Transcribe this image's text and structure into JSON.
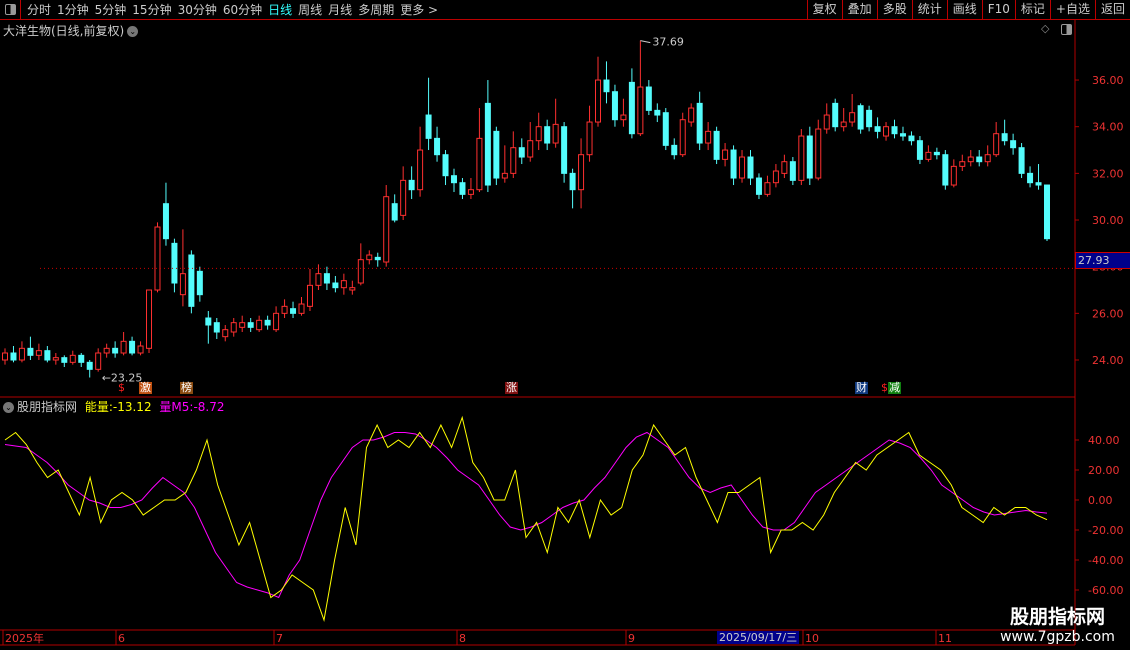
{
  "toolbar": {
    "periods": [
      "分时",
      "1分钟",
      "5分钟",
      "15分钟",
      "30分钟",
      "60分钟",
      "日线",
      "周线",
      "月线",
      "多周期",
      "更多 >"
    ],
    "active_period": "日线",
    "actions": [
      "复权",
      "叠加",
      "多股",
      "统计",
      "画线",
      "F10",
      "标记",
      "+自选",
      "返回"
    ]
  },
  "main": {
    "title": "大洋生物(日线,前复权)",
    "price_ticks": [
      "36.00",
      "34.00",
      "32.00",
      "30.00",
      "28.00",
      "26.00",
      "24.00"
    ],
    "current_price": "27.93",
    "high_label": "37.69",
    "low_label": "23.25",
    "markers": [
      {
        "text": "$",
        "bg": "",
        "color": "#ff2020"
      },
      {
        "text": "激",
        "bg": "#c05010",
        "color": "#fff"
      },
      {
        "text": "榜",
        "bg": "#8a4a10",
        "color": "#fff"
      },
      {
        "text": "涨",
        "bg": "#801010",
        "color": "#fff"
      },
      {
        "text": "财",
        "bg": "#103a80",
        "color": "#fff"
      },
      {
        "text": "$",
        "bg": "",
        "color": "#ff2020"
      },
      {
        "text": "减",
        "bg": "#108010",
        "color": "#fff"
      }
    ]
  },
  "indicator": {
    "name": "股朋指标网",
    "line1_label": "能量:",
    "line1_value": "-13.12",
    "line2_label": "量M5:",
    "line2_value": "-8.72",
    "ticks": [
      "40.00",
      "20.00",
      "0.00",
      "-20.00",
      "-40.00",
      "-60.00"
    ],
    "colors": {
      "line1": "#ffff00",
      "line2": "#ff00ff"
    },
    "line1": [
      40,
      45,
      37,
      25,
      15,
      20,
      5,
      -10,
      15,
      -15,
      0,
      5,
      0,
      -10,
      -5,
      0,
      0,
      5,
      20,
      40,
      10,
      -10,
      -30,
      -15,
      -40,
      -65,
      -60,
      -50,
      -55,
      -60,
      -80,
      -40,
      -5,
      -30,
      35,
      50,
      35,
      40,
      35,
      45,
      35,
      50,
      35,
      55,
      25,
      15,
      0,
      0,
      20,
      -25,
      -15,
      -35,
      -5,
      -15,
      0,
      -25,
      0,
      -10,
      -5,
      20,
      30,
      50,
      40,
      30,
      35,
      15,
      0,
      -15,
      5,
      5,
      10,
      15,
      -35,
      -20,
      -20,
      -15,
      -20,
      -10,
      5,
      15,
      25,
      20,
      30,
      35,
      40,
      45,
      30,
      25,
      20,
      10,
      -5,
      -10,
      -15,
      -5,
      -10,
      -5,
      -5,
      -10,
      -13.12
    ],
    "line2": [
      37,
      36,
      35,
      30,
      25,
      18,
      10,
      5,
      0,
      -2,
      -5,
      -5,
      -3,
      0,
      8,
      15,
      10,
      5,
      -5,
      -20,
      -35,
      -45,
      -55,
      -58,
      -60,
      -62,
      -65,
      -50,
      -40,
      -20,
      0,
      15,
      25,
      35,
      40,
      40,
      42,
      45,
      45,
      44,
      40,
      35,
      28,
      20,
      15,
      10,
      0,
      -10,
      -18,
      -20,
      -18,
      -15,
      -10,
      -5,
      -2,
      0,
      8,
      15,
      25,
      35,
      42,
      45,
      40,
      35,
      25,
      15,
      8,
      5,
      8,
      10,
      0,
      -10,
      -18,
      -20,
      -20,
      -15,
      -5,
      5,
      10,
      15,
      20,
      25,
      30,
      35,
      40,
      38,
      35,
      28,
      20,
      10,
      5,
      0,
      -5,
      -8,
      -10,
      -9,
      -8,
      -7,
      -8,
      -8.72
    ]
  },
  "candles": [
    [
      24.0,
      24.3,
      24.5,
      23.8
    ],
    [
      24.3,
      24.0,
      24.6,
      23.9
    ],
    [
      24.0,
      24.5,
      24.8,
      23.9
    ],
    [
      24.5,
      24.2,
      25.0,
      24.0
    ],
    [
      24.2,
      24.4,
      24.7,
      24.0
    ],
    [
      24.4,
      24.0,
      24.6,
      23.9
    ],
    [
      24.0,
      24.1,
      24.3,
      23.8
    ],
    [
      24.1,
      23.9,
      24.2,
      23.7
    ],
    [
      23.9,
      24.2,
      24.4,
      23.8
    ],
    [
      24.2,
      23.9,
      24.3,
      23.7
    ],
    [
      23.9,
      23.6,
      24.0,
      23.25
    ],
    [
      23.6,
      24.3,
      24.5,
      23.5
    ],
    [
      24.3,
      24.5,
      24.7,
      24.1
    ],
    [
      24.5,
      24.3,
      24.8,
      24.1
    ],
    [
      24.3,
      24.8,
      25.2,
      24.2
    ],
    [
      24.8,
      24.3,
      25.0,
      24.2
    ],
    [
      24.3,
      24.6,
      24.8,
      24.2
    ],
    [
      24.5,
      27.0,
      27.0,
      24.3
    ],
    [
      27.0,
      29.7,
      29.9,
      26.9
    ],
    [
      30.7,
      29.2,
      31.6,
      28.9
    ],
    [
      29.0,
      27.3,
      29.2,
      26.9
    ],
    [
      26.8,
      27.7,
      29.6,
      26.3
    ],
    [
      28.5,
      26.3,
      28.7,
      26.0
    ],
    [
      27.8,
      26.8,
      28.0,
      26.5
    ],
    [
      25.8,
      25.5,
      26.1,
      24.7
    ],
    [
      25.6,
      25.2,
      25.8,
      24.9
    ],
    [
      25.0,
      25.3,
      25.5,
      24.8
    ],
    [
      25.2,
      25.6,
      25.8,
      25.0
    ],
    [
      25.4,
      25.6,
      25.9,
      25.2
    ],
    [
      25.6,
      25.4,
      25.8,
      25.2
    ],
    [
      25.3,
      25.7,
      25.9,
      25.2
    ],
    [
      25.7,
      25.5,
      25.9,
      25.3
    ],
    [
      25.3,
      26.0,
      26.3,
      25.2
    ],
    [
      26.0,
      26.3,
      26.6,
      25.8
    ],
    [
      26.2,
      26.0,
      26.5,
      25.8
    ],
    [
      26.0,
      26.4,
      26.7,
      25.9
    ],
    [
      26.3,
      27.2,
      27.9,
      26.1
    ],
    [
      27.2,
      27.7,
      28.1,
      27.0
    ],
    [
      27.7,
      27.3,
      28.0,
      27.0
    ],
    [
      27.3,
      27.1,
      27.6,
      26.9
    ],
    [
      27.1,
      27.4,
      27.7,
      26.8
    ],
    [
      27.0,
      27.1,
      27.4,
      26.8
    ],
    [
      27.3,
      28.3,
      29.0,
      27.2
    ],
    [
      28.3,
      28.5,
      28.7,
      28.1
    ],
    [
      28.4,
      28.3,
      28.6,
      28.0
    ],
    [
      28.2,
      31.0,
      31.5,
      28.0
    ],
    [
      30.7,
      30.0,
      31.1,
      29.9
    ],
    [
      30.2,
      31.7,
      32.3,
      30.0
    ],
    [
      31.7,
      31.3,
      32.3,
      30.9
    ],
    [
      31.3,
      33.0,
      34.0,
      31.0
    ],
    [
      34.5,
      33.5,
      36.1,
      33.0
    ],
    [
      33.5,
      32.8,
      34.0,
      32.5
    ],
    [
      32.8,
      31.9,
      33.0,
      31.5
    ],
    [
      31.9,
      31.6,
      32.2,
      31.2
    ],
    [
      31.6,
      31.1,
      31.8,
      30.9
    ],
    [
      31.1,
      31.3,
      31.8,
      30.9
    ],
    [
      31.3,
      33.5,
      34.8,
      31.2
    ],
    [
      35.0,
      31.5,
      36.0,
      31.2
    ],
    [
      33.8,
      31.8,
      34.0,
      31.5
    ],
    [
      31.8,
      32.0,
      33.2,
      31.6
    ],
    [
      32.0,
      33.1,
      33.8,
      31.8
    ],
    [
      33.1,
      32.7,
      33.5,
      32.4
    ],
    [
      32.7,
      33.4,
      34.2,
      32.5
    ],
    [
      33.4,
      34.0,
      34.6,
      33.0
    ],
    [
      34.0,
      33.3,
      34.3,
      33.0
    ],
    [
      33.3,
      34.1,
      35.2,
      33.1
    ],
    [
      34.0,
      32.0,
      34.2,
      31.6
    ],
    [
      32.0,
      31.3,
      32.2,
      30.5
    ],
    [
      31.3,
      32.8,
      33.5,
      30.5
    ],
    [
      32.8,
      34.2,
      34.9,
      32.5
    ],
    [
      34.2,
      36.0,
      37.0,
      34.0
    ],
    [
      36.0,
      35.5,
      36.8,
      35.0
    ],
    [
      35.5,
      34.3,
      35.8,
      34.0
    ],
    [
      34.3,
      34.5,
      35.2,
      34.0
    ],
    [
      35.9,
      33.7,
      36.5,
      33.5
    ],
    [
      33.7,
      35.7,
      37.69,
      33.6
    ],
    [
      35.7,
      34.7,
      36.0,
      34.5
    ],
    [
      34.7,
      34.5,
      35.0,
      34.2
    ],
    [
      34.6,
      33.2,
      34.8,
      33.0
    ],
    [
      33.2,
      32.8,
      33.5,
      32.6
    ],
    [
      32.8,
      34.3,
      34.6,
      32.7
    ],
    [
      34.2,
      34.8,
      35.0,
      34.0
    ],
    [
      35.0,
      33.3,
      35.5,
      33.0
    ],
    [
      33.3,
      33.8,
      34.2,
      33.0
    ],
    [
      33.8,
      32.6,
      34.0,
      32.4
    ],
    [
      32.6,
      33.0,
      33.3,
      32.3
    ],
    [
      33.0,
      31.8,
      33.2,
      31.5
    ],
    [
      31.8,
      32.7,
      33.0,
      31.6
    ],
    [
      32.7,
      31.8,
      33.0,
      31.5
    ],
    [
      31.8,
      31.1,
      32.0,
      30.9
    ],
    [
      31.1,
      31.6,
      31.9,
      31.0
    ],
    [
      31.6,
      32.1,
      32.4,
      31.4
    ],
    [
      32.0,
      32.5,
      32.8,
      31.8
    ],
    [
      32.5,
      31.7,
      32.7,
      31.5
    ],
    [
      31.7,
      33.6,
      33.9,
      31.5
    ],
    [
      33.6,
      31.8,
      34.0,
      31.5
    ],
    [
      31.8,
      33.9,
      34.3,
      31.7
    ],
    [
      33.9,
      34.5,
      35.0,
      33.7
    ],
    [
      35.0,
      34.0,
      35.2,
      33.8
    ],
    [
      34.0,
      34.2,
      34.8,
      33.8
    ],
    [
      34.2,
      34.6,
      35.4,
      34.0
    ],
    [
      34.9,
      33.9,
      35.0,
      33.7
    ],
    [
      34.7,
      34.0,
      34.9,
      33.8
    ],
    [
      34.0,
      33.8,
      34.4,
      33.5
    ],
    [
      33.6,
      34.0,
      34.2,
      33.4
    ],
    [
      34.0,
      33.7,
      34.3,
      33.5
    ],
    [
      33.7,
      33.6,
      34.0,
      33.4
    ],
    [
      33.6,
      33.4,
      33.8,
      33.2
    ],
    [
      33.4,
      32.6,
      33.6,
      32.4
    ],
    [
      32.6,
      32.9,
      33.2,
      32.5
    ],
    [
      32.9,
      32.8,
      33.1,
      32.6
    ],
    [
      32.8,
      31.5,
      33.0,
      31.3
    ],
    [
      31.5,
      32.3,
      32.6,
      31.4
    ],
    [
      32.3,
      32.5,
      32.8,
      32.1
    ],
    [
      32.5,
      32.7,
      33.0,
      32.3
    ],
    [
      32.7,
      32.5,
      33.0,
      32.3
    ],
    [
      32.5,
      32.8,
      33.2,
      32.3
    ],
    [
      32.8,
      33.7,
      34.2,
      32.7
    ],
    [
      33.7,
      33.4,
      34.3,
      33.2
    ],
    [
      33.4,
      33.1,
      33.7,
      32.8
    ],
    [
      33.1,
      32.0,
      33.3,
      31.8
    ],
    [
      32.0,
      31.6,
      32.3,
      31.4
    ],
    [
      31.6,
      31.5,
      32.4,
      31.3
    ],
    [
      31.5,
      29.2,
      31.5,
      29.1
    ]
  ],
  "date_axis": {
    "labels": [
      "2025年",
      "6",
      "7",
      "8",
      "9",
      "10",
      "11"
    ],
    "cursor_date": "2025/09/17/三"
  },
  "watermark": {
    "line1": "股朋指标网",
    "line2": "www.7gpzb.com"
  },
  "colors": {
    "up": "#ff3030",
    "down": "#54fcfc",
    "grid": "#b00000",
    "axis_text": "#e33"
  }
}
